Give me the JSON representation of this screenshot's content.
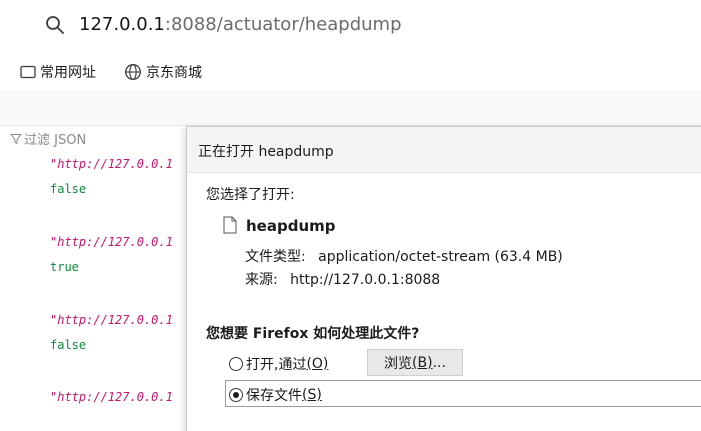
{
  "address_bar": {
    "url_host": "127.0.0.1",
    "url_rest": ":8088/actuator/heapdump"
  },
  "bookmarks": [
    {
      "label": "常用网址",
      "icon": "folder-icon"
    },
    {
      "label": "京东商城",
      "icon": "globe-icon"
    }
  ],
  "json_viewer": {
    "filter_label": "过滤 JSON",
    "lines": [
      {
        "key": "\"http://127.0.0.1",
        "value": "false"
      },
      {
        "key": "\"http://127.0.0.1",
        "value": "true"
      },
      {
        "key": "\"http://127.0.0.1",
        "value": "false"
      },
      {
        "key": "\"http://127.0.0.1",
        "value": ""
      }
    ]
  },
  "dialog": {
    "title": "正在打开 heapdump",
    "intro": "您选择了打开:",
    "file_name": "heapdump",
    "file_type_label": "文件类型:",
    "file_type_value": "application/octet-stream (63.4 MB)",
    "source_label": "来源:",
    "source_value": "http://127.0.0.1:8088",
    "question": "您想要 Firefox 如何处理此文件?",
    "open_with_label": "打开,通过",
    "open_with_key": "(O)",
    "browse_label": "浏览",
    "browse_key": "(B)",
    "browse_suffix": "...",
    "save_label": "保存文件",
    "save_key": "(S)",
    "selected_option": "save"
  }
}
